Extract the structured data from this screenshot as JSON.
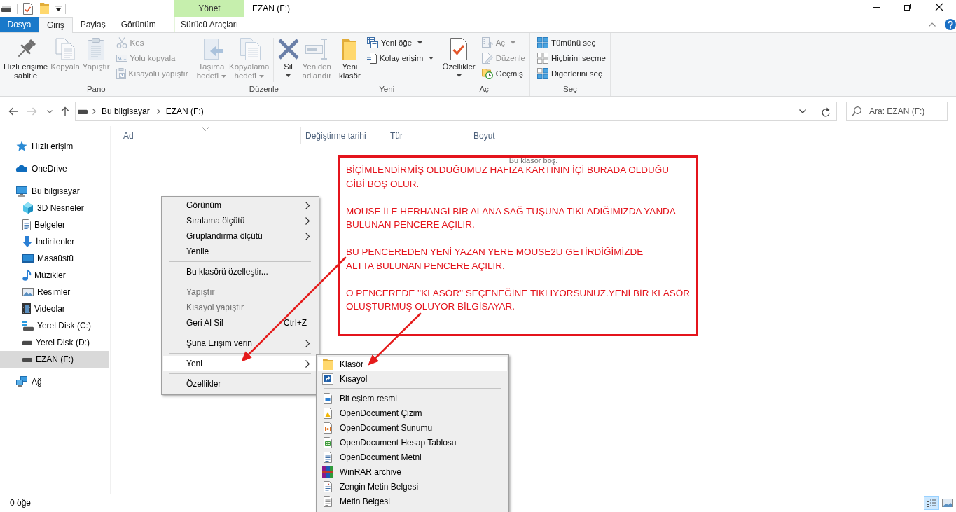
{
  "window": {
    "title": "EZAN (F:)",
    "tab_group": "Yönet"
  },
  "ribbon_tabs": [
    {
      "label": "Dosya",
      "kind": "file",
      "selected": false
    },
    {
      "label": "Giriş",
      "kind": "tab",
      "selected": true
    },
    {
      "label": "Paylaş",
      "kind": "tab",
      "selected": false
    },
    {
      "label": "Görünüm",
      "kind": "tab",
      "selected": false
    },
    {
      "label": "Sürücü Araçları",
      "kind": "context",
      "selected": false
    }
  ],
  "ribbon_groups": [
    {
      "label": "Pano",
      "sections": [
        [
          {
            "kind": "large",
            "label": "Hızlı erişime\nsabitle",
            "disabled": false,
            "dropdown": false
          },
          {
            "kind": "large",
            "label": "Kopyala",
            "disabled": true,
            "dropdown": false
          },
          {
            "kind": "large",
            "label": "Yapıştır",
            "disabled": true,
            "dropdown": false
          },
          {
            "kind": "stack",
            "items": [
              {
                "label": "Kes",
                "disabled": true,
                "dropdown": false
              },
              {
                "label": "Yolu kopyala",
                "disabled": true,
                "dropdown": false
              },
              {
                "label": "Kısayolu yapıştır",
                "disabled": true,
                "dropdown": false
              }
            ]
          }
        ]
      ]
    },
    {
      "label": "Düzenle",
      "sections": [
        [
          {
            "kind": "large",
            "label": "Taşıma\nhedefi",
            "disabled": true,
            "dropdown": true
          },
          {
            "kind": "large",
            "label": "Kopyalama\nhedefi",
            "disabled": true,
            "dropdown": true
          }
        ],
        [
          {
            "kind": "large",
            "label": "Sil",
            "disabled": false,
            "dropdown": true
          },
          {
            "kind": "large",
            "label": "Yeniden\nadlandır",
            "disabled": true,
            "dropdown": false
          }
        ]
      ]
    },
    {
      "label": "Yeni",
      "sections": [
        [
          {
            "kind": "large",
            "label": "Yeni\nklasör",
            "disabled": false,
            "dropdown": false
          },
          {
            "kind": "stack",
            "items": [
              {
                "label": "Yeni öğe",
                "disabled": false,
                "dropdown": true
              },
              {
                "label": "Kolay erişim",
                "disabled": false,
                "dropdown": true
              }
            ]
          }
        ]
      ]
    },
    {
      "label": "Aç",
      "sections": [
        [
          {
            "kind": "large",
            "label": "Özellikler",
            "disabled": false,
            "dropdown": true
          },
          {
            "kind": "stack",
            "items": [
              {
                "label": "Aç",
                "disabled": true,
                "dropdown": true
              },
              {
                "label": "Düzenle",
                "disabled": true,
                "dropdown": false
              },
              {
                "label": "Geçmiş",
                "disabled": false,
                "dropdown": false
              }
            ]
          }
        ]
      ]
    },
    {
      "label": "Seç",
      "sections": [
        [
          {
            "kind": "stack",
            "items": [
              {
                "label": "Tümünü seç",
                "disabled": false,
                "dropdown": false
              },
              {
                "label": "Hiçbirini seçme",
                "disabled": false,
                "dropdown": false
              },
              {
                "label": "Diğerlerini seç",
                "disabled": false,
                "dropdown": false
              }
            ]
          }
        ]
      ]
    }
  ],
  "navigation": {
    "back": {
      "disabled": false
    },
    "forward": {
      "disabled": true
    }
  },
  "address_bar": {
    "path": [
      "Bu bilgisayar",
      "EZAN (F:)"
    ]
  },
  "search": {
    "placeholder": "Ara: EZAN (F:)"
  },
  "sidebar": {
    "items": [
      {
        "label": "Hızlı erişim",
        "selected": false
      },
      {
        "label": "OneDrive",
        "selected": false
      },
      {
        "label": "Bu bilgisayar",
        "selected": false,
        "children": [
          {
            "label": "3D Nesneler",
            "selected": false
          },
          {
            "label": "Belgeler",
            "selected": false
          },
          {
            "label": "İndirilenler",
            "selected": false
          },
          {
            "label": "Masaüstü",
            "selected": false
          },
          {
            "label": "Müzikler",
            "selected": false
          },
          {
            "label": "Resimler",
            "selected": false
          },
          {
            "label": "Videolar",
            "selected": false
          },
          {
            "label": "Yerel Disk (C:)",
            "selected": false
          },
          {
            "label": "Yerel Disk (D:)",
            "selected": false
          },
          {
            "label": "EZAN (F:)",
            "selected": true
          }
        ]
      },
      {
        "label": "Ağ",
        "selected": false
      }
    ]
  },
  "columns": [
    {
      "label": "Ad",
      "sorted": true
    },
    {
      "label": "Değiştirme tarihi",
      "sorted": false
    },
    {
      "label": "Tür",
      "sorted": false
    },
    {
      "label": "Boyut",
      "sorted": false
    }
  ],
  "empty_message": "Bu klasör boş.",
  "status_bar": {
    "item_count": "0 öğe",
    "views": [
      {
        "selected": true
      },
      {
        "selected": false
      }
    ]
  },
  "context_menu": {
    "sections": [
      [
        {
          "label": "Görünüm",
          "submenu": true,
          "disabled": false,
          "selected": false
        },
        {
          "label": "Sıralama ölçütü",
          "submenu": true,
          "disabled": false,
          "selected": false
        },
        {
          "label": "Gruplandırma ölçütü",
          "submenu": true,
          "disabled": false,
          "selected": false
        },
        {
          "label": "Yenile",
          "submenu": false,
          "disabled": false,
          "selected": false
        }
      ],
      [
        {
          "label": "Bu klasörü özelleştir...",
          "submenu": false,
          "disabled": false,
          "selected": false
        }
      ],
      [
        {
          "label": "Yapıştır",
          "submenu": false,
          "disabled": true,
          "selected": false
        },
        {
          "label": "Kısayol yapıştır",
          "submenu": false,
          "disabled": true,
          "selected": false
        },
        {
          "label": "Geri Al Sil",
          "shortcut": "Ctrl+Z",
          "submenu": false,
          "disabled": false,
          "selected": false
        }
      ],
      [
        {
          "label": "Şuna Erişim verin",
          "submenu": true,
          "disabled": false,
          "selected": false
        }
      ],
      [
        {
          "label": "Yeni",
          "submenu": true,
          "disabled": false,
          "selected": true
        }
      ],
      [
        {
          "label": "Özellikler",
          "submenu": false,
          "disabled": false,
          "selected": false
        }
      ]
    ]
  },
  "new_submenu": {
    "sections": [
      [
        {
          "label": "Klasör",
          "selected": true
        },
        {
          "label": "Kısayol",
          "selected": false
        }
      ],
      [
        {
          "label": "Bit eşlem resmi",
          "selected": false
        },
        {
          "label": "OpenDocument Çizim",
          "selected": false
        },
        {
          "label": "OpenDocument Sunumu",
          "selected": false
        },
        {
          "label": "OpenDocument Hesap Tablosu",
          "selected": false
        },
        {
          "label": "OpenDocument Metni",
          "selected": false
        },
        {
          "label": "WinRAR archive",
          "selected": false
        },
        {
          "label": "Zengin Metin Belgesi",
          "selected": false
        },
        {
          "label": "Metin Belgesi",
          "selected": false
        }
      ]
    ]
  },
  "annotation": {
    "paragraphs": [
      "BİÇİMLENDİRMİŞ OLDUĞUMUZ HAFIZA KARTININ İÇİ BURADA OLDUĞU\nGİBİ BOŞ OLUR.",
      "MOUSE İLE HERHANGİ BİR ALANA SAĞ TUŞUNA TIKLADIĞIMIZDA YANDA\nBULUNAN PENCERE AÇILIR.",
      "BU PENCEREDEN YENİ YAZAN YERE MOUSE2U GETİRDİĞİMİZDE\nALTTA BULUNAN PENCERE AÇILIR.",
      "O PENCEREDE ''KLASÖR'' SEÇENEĞİNE TIKLIYORSUNUZ.YENİ BİR KLASÖR\nOLUŞTURMUŞ OLUYOR BİLGİSAYAR."
    ]
  }
}
